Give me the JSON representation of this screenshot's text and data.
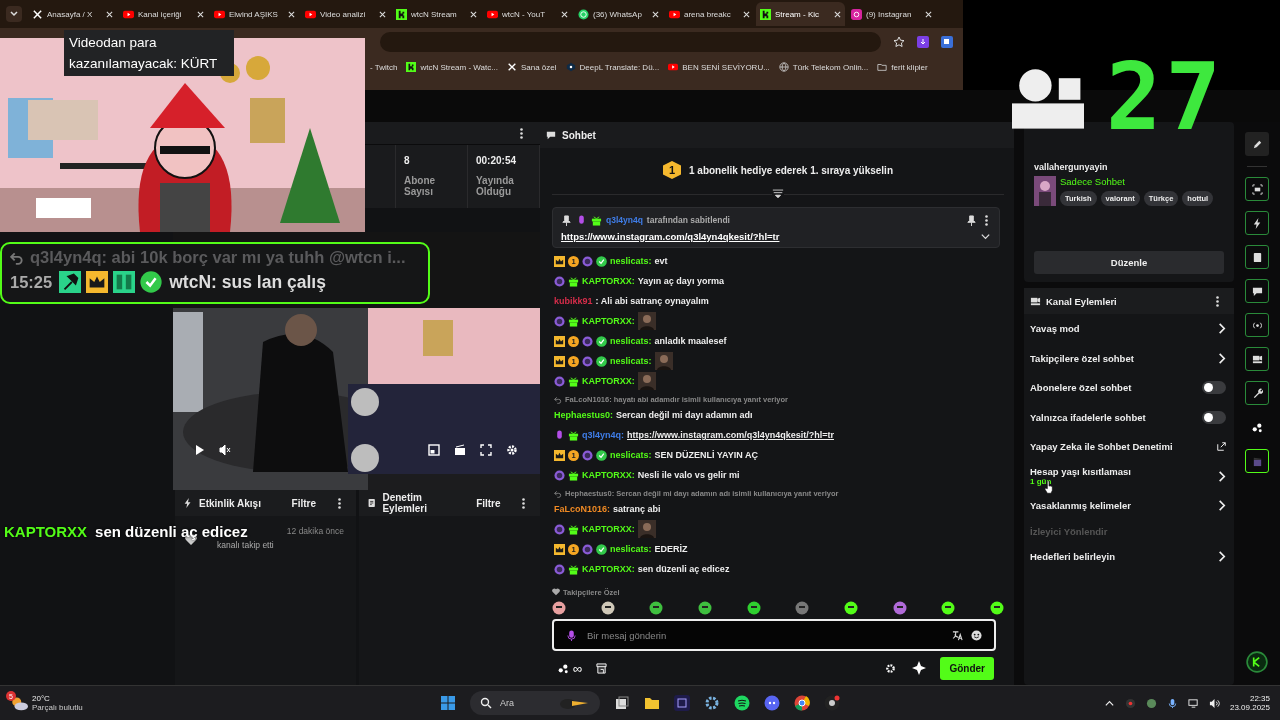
{
  "browser": {
    "tabs": [
      {
        "label": "Anasayfa / X",
        "kind": "x",
        "selected": false
      },
      {
        "label": "Kanal içeriği",
        "kind": "youtube",
        "selected": false
      },
      {
        "label": "Elwind AŞIKS",
        "kind": "youtube",
        "selected": false
      },
      {
        "label": "Video analizi",
        "kind": "youtube",
        "selected": false
      },
      {
        "label": "wtcN Stream",
        "kind": "kick",
        "selected": false
      },
      {
        "label": "wtcN - YouT",
        "kind": "youtube",
        "selected": false
      },
      {
        "label": "(36) WhatsAp",
        "kind": "whatsapp",
        "selected": false
      },
      {
        "label": "arena breakc",
        "kind": "youtube",
        "selected": false
      },
      {
        "label": "Stream - Kic",
        "kind": "kick",
        "selected": true
      },
      {
        "label": "(9) Instagran",
        "kind": "instagram",
        "selected": false
      }
    ],
    "bookmarks": [
      {
        "label": "- Twitch",
        "kind": "plain"
      },
      {
        "label": "wtcN Stream - Watc...",
        "kind": "kick"
      },
      {
        "label": "Sana özel",
        "kind": "x"
      },
      {
        "label": "DeepL Translate: Dü...",
        "kind": "deepl"
      },
      {
        "label": "BEN SENİ SEVİYORU...",
        "kind": "youtube"
      },
      {
        "label": "Türk Telekom Onlin...",
        "kind": "globe"
      },
      {
        "label": "ferit klipler",
        "kind": "folder"
      }
    ]
  },
  "stream_preview": {
    "caption": "Videodan para kazanılamayacak: KÜRT"
  },
  "viewer_overlay": {
    "count": "27"
  },
  "stats": [
    {
      "value": "8",
      "label": "Abone Sayısı"
    },
    {
      "value": "00:20:54",
      "label": "Yayında Olduğu"
    }
  ],
  "chat_overlay": {
    "reply": "q3l4yn4q: abi 10k borç var mı ya tuhh @wtcn i...",
    "time": "15:25",
    "user": "wtcN:",
    "text": "sus lan çalış"
  },
  "caption_overlay": {
    "user": "KAPTORXX",
    "text": "sen düzenli aç edicez"
  },
  "panels": [
    {
      "title": "Etkinlik Akışı",
      "kind": "bolt",
      "filter": "Filtre",
      "events": [
        {
          "time": "12 dakika önce",
          "text": "kanalı takip etti"
        }
      ]
    },
    {
      "title": "Denetim Eylemleri",
      "kind": "doc",
      "filter": "Filtre"
    }
  ],
  "chat": {
    "title": "Sohbet",
    "banner": {
      "rank": "1",
      "text": "1 abonelik hediye ederek 1. sıraya yükselin"
    },
    "pinned": {
      "user": "q3l4yn4q",
      "note": "tarafından sabitlendi",
      "link": "https://www.instagram.com/q3l4yn4qkesit/?hl=tr"
    },
    "messages": [
      {
        "badges": [
          {
            "kind": "crown"
          },
          {
            "kind": "sub",
            "label": "1"
          },
          {
            "kind": "round"
          },
          {
            "kind": "verified"
          }
        ],
        "user": "neslicats:",
        "color": "#53fc18",
        "kind": "text",
        "text": "evt"
      },
      {
        "badges": [
          {
            "kind": "round"
          },
          {
            "kind": "gift"
          }
        ],
        "user": "KAPTORXX:",
        "color": "#53fc18",
        "kind": "text",
        "text": "Yayın aç dayı yorma"
      },
      {
        "user": "kubikk91",
        "color": "#d62d4a",
        "kind": "text",
        "text": ": Ali abi satranç oynayalım"
      },
      {
        "badges": [
          {
            "kind": "round"
          },
          {
            "kind": "gift"
          }
        ],
        "user": "KAPTORXX:",
        "color": "#53fc18",
        "kind": "emote"
      },
      {
        "badges": [
          {
            "kind": "crown"
          },
          {
            "kind": "sub",
            "label": "1"
          },
          {
            "kind": "round"
          },
          {
            "kind": "verified"
          }
        ],
        "user": "neslicats:",
        "color": "#53fc18",
        "kind": "text",
        "text": "anladık maalesef"
      },
      {
        "badges": [
          {
            "kind": "crown"
          },
          {
            "kind": "sub",
            "label": "1"
          },
          {
            "kind": "round"
          },
          {
            "kind": "verified"
          }
        ],
        "user": "neslicats:",
        "color": "#53fc18",
        "kind": "emote"
      },
      {
        "badges": [
          {
            "kind": "round"
          },
          {
            "kind": "gift"
          }
        ],
        "user": "KAPTORXX:",
        "color": "#53fc18",
        "kind": "emote"
      },
      {
        "reply": "FaLcoN1016: hayatı abi adamdır isimli kullanıcıya yanıt veriyor",
        "user": "Hephaestus0:",
        "color": "#53fc18",
        "kind": "text",
        "text": "Sercan değil mi dayı adamın adı"
      },
      {
        "badges": [
          {
            "kind": "mic"
          },
          {
            "kind": "gift"
          }
        ],
        "user": "q3l4yn4q:",
        "color": "#3f7de8",
        "kind": "link",
        "text": "https://www.instagram.com/q3l4yn4qkesit/?hl=tr"
      },
      {
        "badges": [
          {
            "kind": "crown"
          },
          {
            "kind": "sub",
            "label": "1"
          },
          {
            "kind": "round"
          },
          {
            "kind": "verified"
          }
        ],
        "user": "neslicats:",
        "color": "#53fc18",
        "kind": "text",
        "text": "SEN DÜZENLİ YAYIN AÇ"
      },
      {
        "badges": [
          {
            "kind": "round"
          },
          {
            "kind": "gift"
          }
        ],
        "user": "KAPTORXX:",
        "color": "#53fc18",
        "kind": "text",
        "text": "Nesli ile valo vs gelir mi"
      },
      {
        "reply": "Hephaestus0: Sercan değil mi dayı adamın adı isimli kullanıcıya yanıt veriyor",
        "user": "FaLcoN1016:",
        "color": "#f08a24",
        "kind": "text",
        "text": "satranç abi"
      },
      {
        "badges": [
          {
            "kind": "round"
          },
          {
            "kind": "gift"
          }
        ],
        "user": "KAPTORXX:",
        "color": "#53fc18",
        "kind": "emote"
      },
      {
        "badges": [
          {
            "kind": "crown"
          },
          {
            "kind": "sub",
            "label": "1"
          },
          {
            "kind": "round"
          },
          {
            "kind": "verified"
          }
        ],
        "user": "neslicats:",
        "color": "#53fc18",
        "kind": "text",
        "text": "EDERİZ"
      },
      {
        "badges": [
          {
            "kind": "round"
          },
          {
            "kind": "gift"
          }
        ],
        "user": "KAPTORXX:",
        "color": "#53fc18",
        "kind": "text",
        "text": "sen düzenli aç edicez"
      }
    ],
    "emote_label": "Takipçilere Özel",
    "input": {
      "placeholder": "Bir mesaj gönderin"
    },
    "points": "∞",
    "send": "Gönder"
  },
  "channel_card": {
    "name": "vallahergunyayin",
    "category": "Sadece Sohbet",
    "tags": [
      "Turkish",
      "valorant",
      "Türkçe",
      "hottul"
    ],
    "edit": "Düzenle"
  },
  "channel_actions": {
    "title": "Kanal Eylemleri",
    "items": [
      {
        "label": "Yavaş mod",
        "kind": "arrow"
      },
      {
        "label": "Takipçilere özel sohbet",
        "kind": "arrow"
      },
      {
        "label": "Abonelere özel sohbet",
        "kind": "toggle",
        "on": false
      },
      {
        "label": "Yalnızca ifadelerle sohbet",
        "kind": "toggle",
        "on": false
      },
      {
        "label": "Yapay Zeka ile Sohbet Denetimi",
        "kind": "external"
      },
      {
        "label": "Hesap yaşı kısıtlaması",
        "kind": "arrow",
        "value": "1 gün"
      },
      {
        "label": "Yasaklanmış kelimeler",
        "kind": "arrow"
      },
      {
        "label": "İzleyici Yönlendir",
        "kind": "section"
      },
      {
        "label": "Hedefleri belirleyin",
        "kind": "arrow"
      }
    ]
  },
  "taskbar": {
    "weather": {
      "temp": "20°C",
      "desc": "Parçalı bulutlu",
      "badge": "5"
    },
    "search": "Ara",
    "time": "22:35",
    "date": "23.09.2025"
  }
}
